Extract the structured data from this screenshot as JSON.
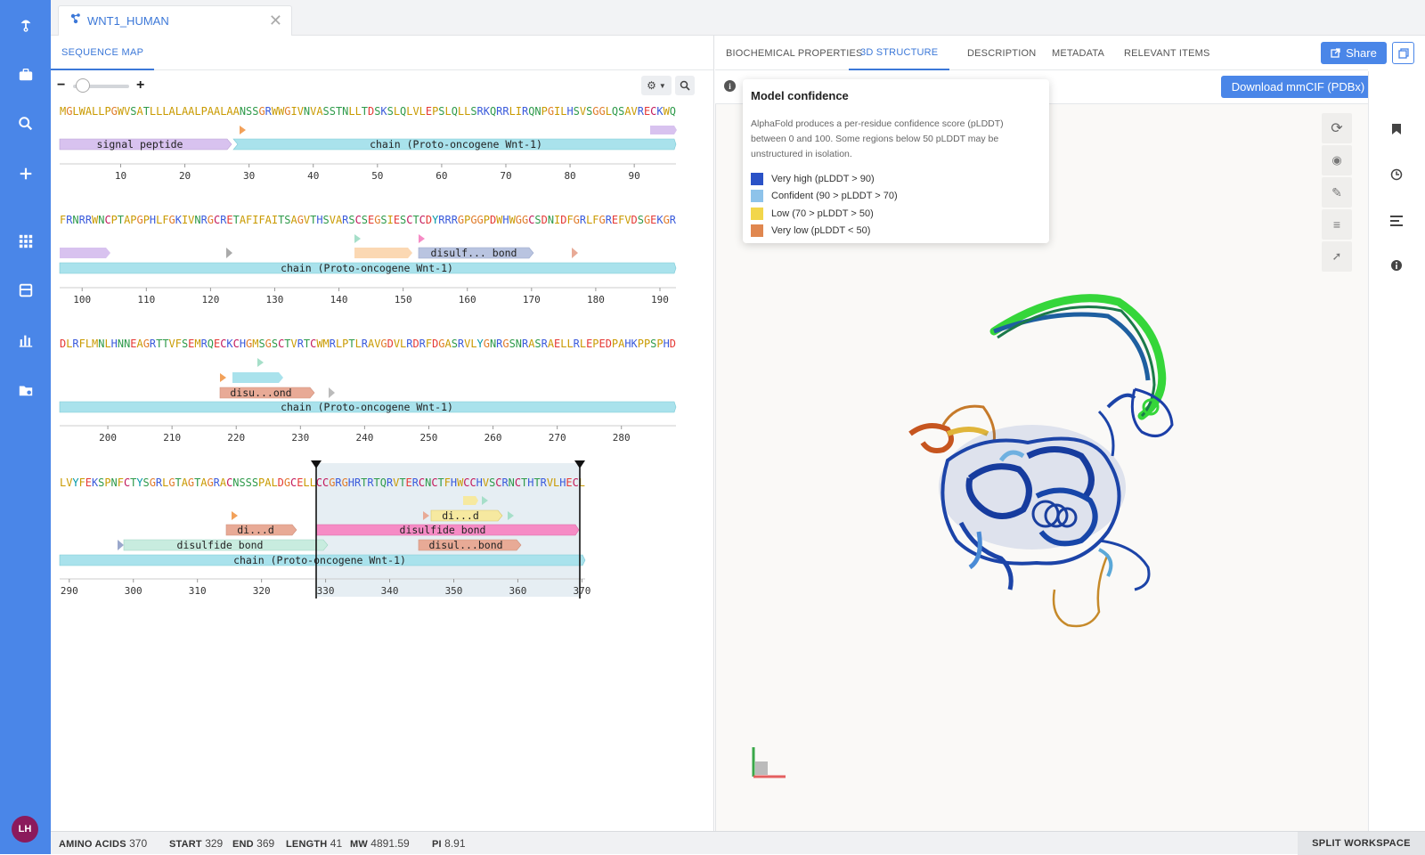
{
  "app": {
    "avatar_initials": "LH",
    "accent": "#4a86e8"
  },
  "document_tab": {
    "title": "WNT1_HUMAN"
  },
  "left_panel": {
    "tab_label": "SEQUENCE MAP"
  },
  "sequence_map": {
    "rows": [
      {
        "sequence": "MGLWALLPGWVSATLLLALAALPAALAANSSGRWWGIVNVASSTNLLTDSKSLQLVLEPSLQLLSRKQRRLIRQNPGILHSVSGGLQSAVRECKWQ",
        "features": [
          {
            "label": "signal peptide",
            "color": "#d8c2ef"
          },
          {
            "label": "chain (Proto-oncogene Wnt-1)",
            "color": "#a9e2ec"
          }
        ],
        "ticks": [
          "10",
          "20",
          "30",
          "40",
          "50",
          "60",
          "70",
          "80",
          "90"
        ]
      },
      {
        "sequence": "FRNRRWNCPTAPGPHLFGKIVNRGCRETAFIFAITSAGVTHSVARSCSEGSIESCTCDYRRRGPGGPDWHWGGCSDNIDFGRLFGREFVDSGEKGR",
        "features": [
          {
            "label": "disulf... bond",
            "color": "#b9c4e0"
          },
          {
            "label": "chain (Proto-oncogene Wnt-1)",
            "color": "#a9e2ec"
          }
        ],
        "ticks": [
          "100",
          "110",
          "120",
          "130",
          "140",
          "150",
          "160",
          "170",
          "180",
          "190"
        ]
      },
      {
        "sequence": "DLRFLMNLHNNEAGRTTVFSEMRQECKCHGMSGSCTVRTCWMRLPTLRAVGDVLRDRFDGASRVLYGNRGSNRASRAELLRLEPEDPAHKPPSPHD",
        "features": [
          {
            "label": "disu...ond",
            "color": "#e8aa96"
          },
          {
            "label": "chain (Proto-oncogene Wnt-1)",
            "color": "#a9e2ec"
          }
        ],
        "ticks": [
          "200",
          "210",
          "220",
          "230",
          "240",
          "250",
          "260",
          "270",
          "280"
        ]
      },
      {
        "sequence": "LVYFEKSPNFCTYSGRLGTAGTAGRACNSSSPALDGCELLCCGRGHRTRTQRVTERCNCTFHWCCHVSCRNCTHTRVLHECL",
        "features": [
          {
            "label": "di...d",
            "color": "#f6e9a0"
          },
          {
            "label": "di...d",
            "color": "#e8aa96"
          },
          {
            "label": "disulfide bond",
            "color": "#f68bc5"
          },
          {
            "label": "disulfide bond",
            "color": "#c8ecdf"
          },
          {
            "label": "disul...bond",
            "color": "#e8aa96"
          },
          {
            "label": "chain (Proto-oncogene Wnt-1)",
            "color": "#a9e2ec"
          }
        ],
        "ticks": [
          "290",
          "300",
          "310",
          "320",
          "330",
          "340",
          "350",
          "360",
          "370"
        ]
      }
    ]
  },
  "right_panel": {
    "tabs": [
      "BIOCHEMICAL PROPERTIES",
      "3D STRUCTURE",
      "DESCRIPTION",
      "METADATA",
      "RELEVANT ITEMS"
    ],
    "active_tab": "3D STRUCTURE",
    "share_label": "Share",
    "download_label": "Download mmCIF (PDBx)"
  },
  "confidence_popover": {
    "title": "Model confidence",
    "description": "AlphaFold produces a per-residue confidence score (pLDDT) between 0 and 100. Some regions below 50 pLDDT may be unstructured in isolation.",
    "legend": [
      {
        "label": "Very high (pLDDT > 90)",
        "color": "#2a52c7"
      },
      {
        "label": "Confident (90 > pLDDT > 70)",
        "color": "#8ec3ea"
      },
      {
        "label": "Low (70 > pLDDT > 50)",
        "color": "#f2d64b"
      },
      {
        "label": "Very low (pLDDT < 50)",
        "color": "#e0874f"
      }
    ]
  },
  "status_bar": {
    "amino_acids_label": "AMINO ACIDS",
    "amino_acids": "370",
    "start_label": "START",
    "start": "329",
    "end_label": "END",
    "end": "369",
    "length_label": "LENGTH",
    "length": "41",
    "mw_label": "MW",
    "mw": "4891.59",
    "pi_label": "PI",
    "pi": "8.91",
    "split_workspace": "SPLIT WORKSPACE"
  }
}
